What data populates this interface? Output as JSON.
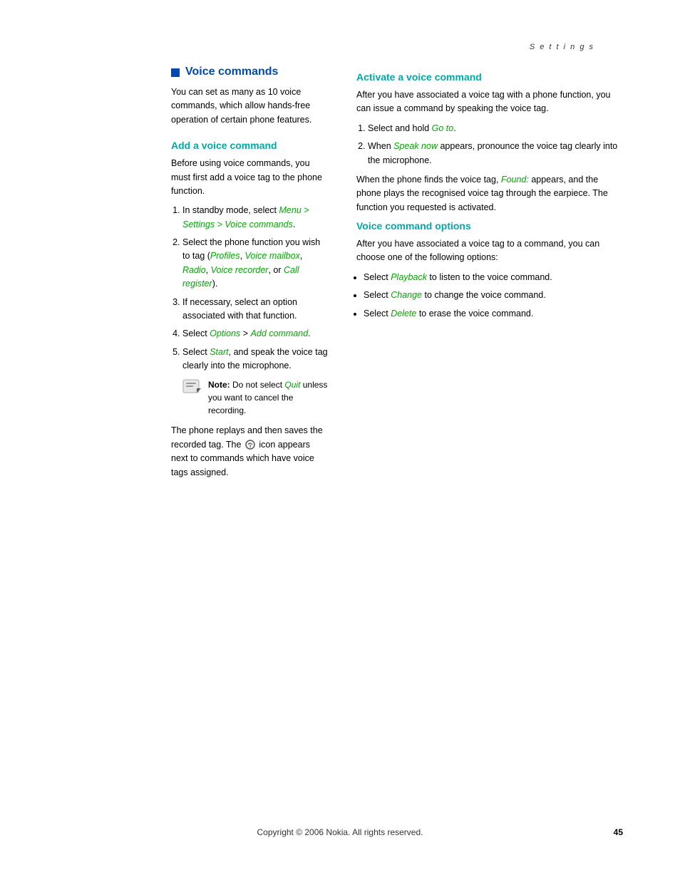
{
  "header": {
    "section_label": "S e t t i n g s"
  },
  "main_section": {
    "title": "Voice commands",
    "intro": "You can set as many as 10 voice commands, which allow hands-free operation of certain phone features."
  },
  "add_voice_command": {
    "heading": "Add a voice command",
    "intro": "Before using voice commands, you must first add a voice tag to the phone function.",
    "steps": [
      {
        "id": 1,
        "text_before": "In standby mode, select ",
        "link1": "Menu > Settings > Voice commands",
        "text_after": "."
      },
      {
        "id": 2,
        "text_before": "Select the phone function you wish to tag (",
        "link1": "Profiles",
        "sep1": ", ",
        "link2": "Voice mailbox",
        "sep2": ", ",
        "link3": "Radio",
        "sep3": ", ",
        "link4": "Voice recorder",
        "sep4": ", or ",
        "link5": "Call register",
        "text_after": ")."
      },
      {
        "id": 3,
        "text": "If necessary, select an option associated with that function."
      },
      {
        "id": 4,
        "text_before": "Select ",
        "link1": "Options",
        "sep1": " > ",
        "link2": "Add command",
        "text_after": "."
      },
      {
        "id": 5,
        "text_before": "Select ",
        "link1": "Start",
        "text_after": ", and speak the voice tag clearly into the microphone."
      }
    ],
    "note_label": "Note:",
    "note_text": " Do not select ",
    "note_link": "Quit",
    "note_text2": " unless you want to cancel the recording.",
    "closing_text": "The phone replays and then saves the recorded tag. The",
    "closing_text2": "icon appears next to commands which have voice tags assigned."
  },
  "activate_voice_command": {
    "heading": "Activate a voice command",
    "intro": "After you have associated a voice tag with a phone function, you can issue a command by speaking the voice tag.",
    "steps": [
      {
        "id": 1,
        "text_before": "Select and hold ",
        "link1": "Go to",
        "text_after": "."
      },
      {
        "id": 2,
        "text_before": "When ",
        "link1": "Speak now",
        "text_after": " appears, pronounce the voice tag clearly into the microphone."
      }
    ],
    "closing": "When the phone finds the voice tag,",
    "closing_link": "Found:",
    "closing_text2": " appears, and the phone plays the recognised voice tag through the earpiece. The function you requested is activated."
  },
  "voice_command_options": {
    "heading": "Voice command options",
    "intro": "After you have associated a voice tag to a command, you can choose one of the following options:",
    "items": [
      {
        "text_before": "Select ",
        "link": "Playback",
        "text_after": " to listen to the voice command."
      },
      {
        "text_before": "Select ",
        "link": "Change",
        "text_after": " to change the voice command."
      },
      {
        "text_before": "Select ",
        "link": "Delete",
        "text_after": " to erase the voice command."
      }
    ]
  },
  "footer": {
    "copyright": "Copyright © 2006 Nokia. All rights reserved.",
    "page_number": "45"
  }
}
